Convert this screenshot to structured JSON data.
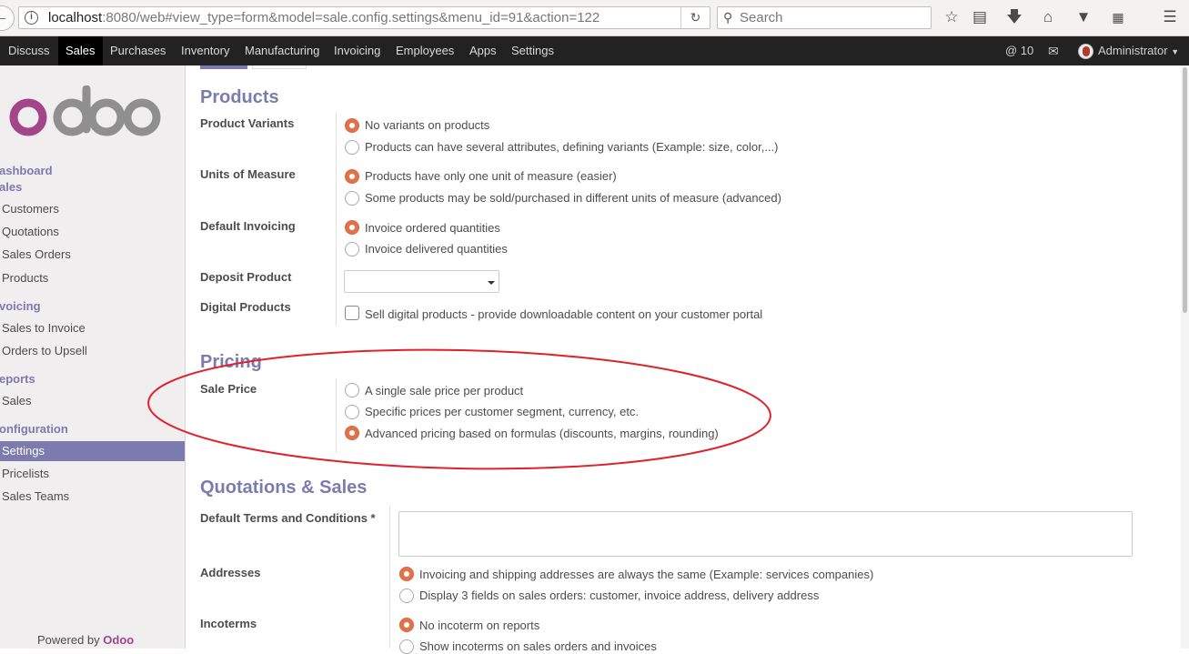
{
  "browser": {
    "url_host": "localhost",
    "url_rest": ":8080/web#view_type=form&model=sale.config.settings&menu_id=91&action=122",
    "search_placeholder": "Search"
  },
  "topnav": {
    "menu": [
      "Discuss",
      "Sales",
      "Purchases",
      "Inventory",
      "Manufacturing",
      "Invoicing",
      "Employees",
      "Apps",
      "Settings"
    ],
    "active": "Sales",
    "mentions_count": "@ 10",
    "user": "Administrator"
  },
  "sidebar": {
    "logo_text": "odoo",
    "dashboard": "ashboard",
    "sales": "ales",
    "items_sales": [
      "Customers",
      "Quotations",
      "Sales Orders",
      "Products"
    ],
    "invoicing": "voicing",
    "items_invoicing": [
      "Sales to Invoice",
      "Orders to Upsell"
    ],
    "reports": "eports",
    "items_reports": [
      "Sales"
    ],
    "configuration": "onfiguration",
    "items_config": [
      "Settings",
      "Pricelists",
      "Sales Teams"
    ],
    "powered_prefix": "Powered by",
    "powered_brand": "Odoo"
  },
  "form": {
    "products_title": "Products",
    "product_variants_label": "Product Variants",
    "product_variants_opt1": "No variants on products",
    "product_variants_opt2": "Products can have several attributes, defining variants (Example: size, color,...)",
    "uom_label": "Units of Measure",
    "uom_opt1": "Products have only one unit of measure (easier)",
    "uom_opt2": "Some products may be sold/purchased in different units of measure (advanced)",
    "invoicing_label": "Default Invoicing",
    "invoicing_opt1": "Invoice ordered quantities",
    "invoicing_opt2": "Invoice delivered quantities",
    "deposit_label": "Deposit Product",
    "deposit_value": "",
    "digital_label": "Digital Products",
    "digital_opt": "Sell digital products - provide downloadable content on your customer portal",
    "pricing_title": "Pricing",
    "sale_price_label": "Sale Price",
    "sale_price_opt1": "A single sale price per product",
    "sale_price_opt2": "Specific prices per customer segment, currency, etc.",
    "sale_price_opt3": "Advanced pricing based on formulas (discounts, margins, rounding)",
    "quotations_title": "Quotations & Sales",
    "terms_label": "Default Terms and Conditions *",
    "terms_value": "",
    "addresses_label": "Addresses",
    "addresses_opt1": "Invoicing and shipping addresses are always the same (Example: services companies)",
    "addresses_opt2": "Display 3 fields on sales orders: customer, invoice address, delivery address",
    "incoterms_label": "Incoterms",
    "incoterms_opt1": "No incoterm on reports",
    "incoterms_opt2": "Show incoterms on sales orders and invoices"
  },
  "colors": {
    "accent": "#7c7bad",
    "radio_selected": "#e0734a",
    "annotation": "#e0202a"
  }
}
